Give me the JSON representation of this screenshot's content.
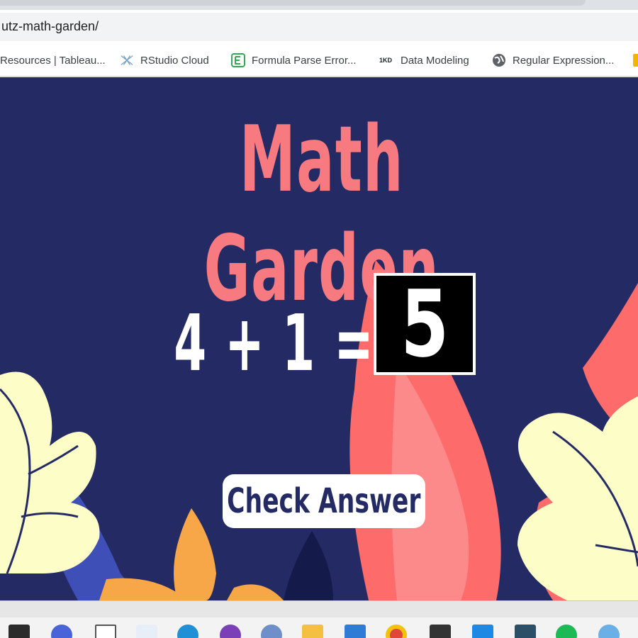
{
  "browser": {
    "url": "utz-math-garden/",
    "bookmarks": [
      {
        "icon": "tableau-icon",
        "label": "Resources | Tableau..."
      },
      {
        "icon": "rstudio-icon",
        "label": "RStudio Cloud"
      },
      {
        "icon": "formula-icon",
        "label": "Formula Parse Error..."
      },
      {
        "icon": "1kd-icon",
        "icon_text": "1KD",
        "label": "Data Modeling"
      },
      {
        "icon": "globe-icon",
        "label": "Regular Expression..."
      }
    ]
  },
  "page": {
    "title": "Math Garden",
    "equation": {
      "left": "4",
      "operator": "+",
      "right": "1",
      "equals": "="
    },
    "drawn_answer": "5",
    "check_button_label": "Check Answer"
  },
  "colors": {
    "background": "#242a64",
    "title": "#f77a80",
    "leaf_yellow": "#fdfdc8",
    "leaf_coral": "#fd6b6b",
    "leaf_pink": "#fd8a8a",
    "leaf_orange": "#f7a747",
    "leaf_blue": "#3f4fb8"
  },
  "taskbar": {
    "apps": [
      "task-view-icon",
      "zoom-icon",
      "file-icon",
      "tableau-icon",
      "edge-icon",
      "podcast-icon",
      "r-icon",
      "folder-icon",
      "store-icon",
      "chrome-icon",
      "terminal-icon",
      "vscode-icon",
      "monitor-icon",
      "spotify-icon",
      "weather-icon"
    ]
  }
}
